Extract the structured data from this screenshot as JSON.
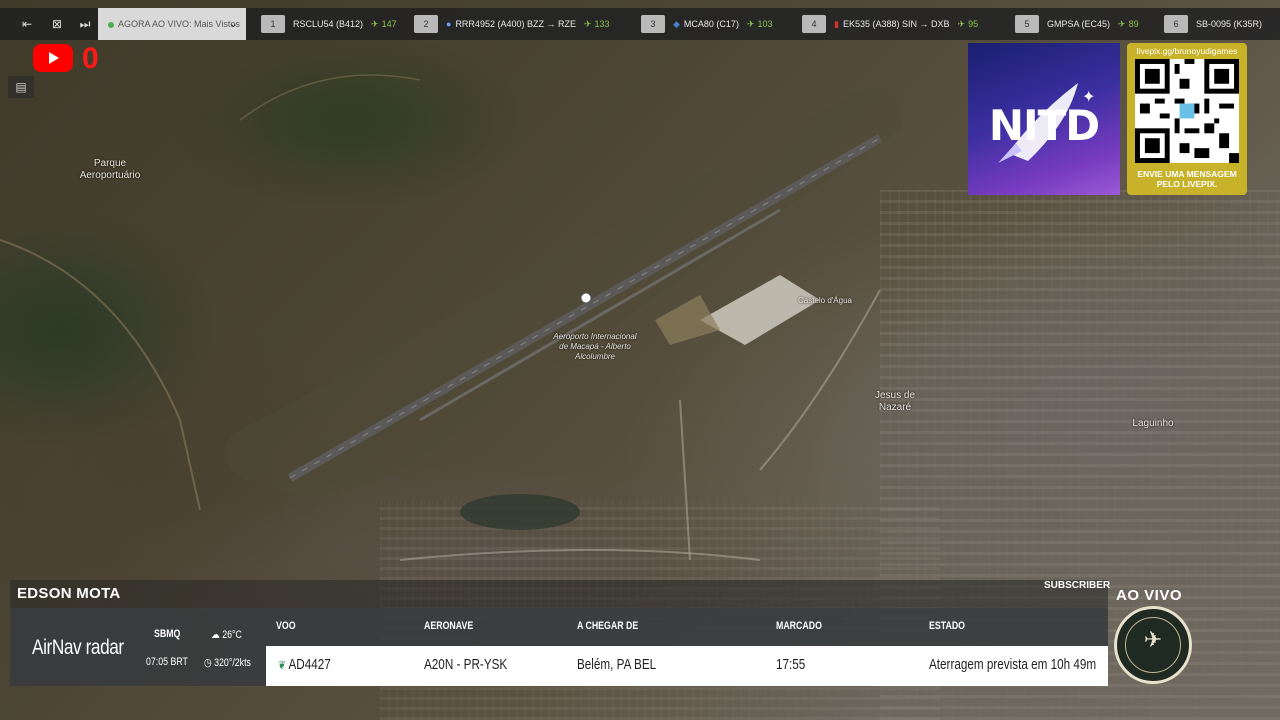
{
  "topbar": {
    "live_label": "AGORA AO VIVO: Mais Vistos",
    "flights": [
      {
        "rank": "1",
        "callsign": "RSCLU54 (B412)",
        "route": "",
        "count": "147"
      },
      {
        "rank": "2",
        "callsign": "RRR4952 (A400)",
        "route": "BZZ → RZE",
        "count": "133"
      },
      {
        "rank": "3",
        "callsign": "MCA80 (C17)",
        "route": "",
        "count": "103"
      },
      {
        "rank": "4",
        "callsign": "EK535 (A388)",
        "route": "SIN → DXB",
        "count": "95"
      },
      {
        "rank": "5",
        "callsign": "GMPSA (EC45)",
        "route": "",
        "count": "89"
      },
      {
        "rank": "6",
        "callsign": "SB-0095 (K35R)",
        "route": "",
        "count": ""
      }
    ]
  },
  "youtube": {
    "count": "0"
  },
  "map": {
    "labels": {
      "park": "Parque\nAeroportuário",
      "airport": "Aeroporto Internacional\nde Macapá - Alberto\nAlcolumbre",
      "castelo": "Castelo d'Água",
      "jesus": "Jesus de\nNazaré",
      "laguinho": "Laguinho"
    }
  },
  "nitd": {
    "text": "NITD"
  },
  "livepix": {
    "url": "livepix.gg/brunoyudigames",
    "message": "ENVIE UMA MENSAGEM\nPELO LIVEPIX."
  },
  "overlay": {
    "driver": "EDSON MOTA",
    "subscriber": "SUBSCRIBER",
    "ao_vivo": "AO VIVO"
  },
  "airnav": {
    "brand": "AirNav radar",
    "airport": "SBMQ",
    "time": "07:05 BRT",
    "temp": "26°C",
    "wind": "320°/2kts",
    "headers": {
      "flight": "VOO",
      "aircraft": "AERONAVE",
      "from": "A CHEGAR DE",
      "scheduled": "MARCADO",
      "status": "ESTADO"
    },
    "row": {
      "flight": "AD4427",
      "aircraft": "A20N - PR-YSK",
      "from": "Belém, PA BEL",
      "scheduled": "17:55",
      "status": "Aterragem prevista em 10h 49m"
    }
  },
  "colors": {
    "accent_green": "#8bc34a",
    "youtube_red": "#ff0000",
    "livepix_gold": "#c7b22a"
  }
}
